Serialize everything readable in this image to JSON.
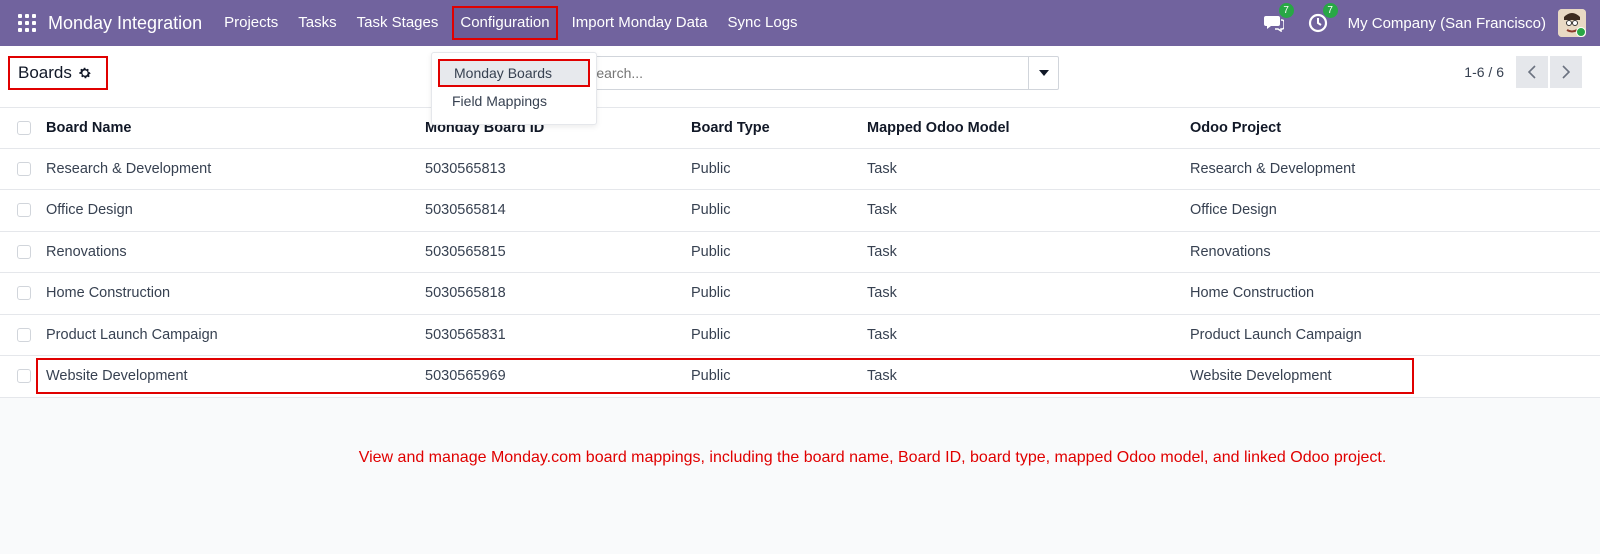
{
  "navbar": {
    "brand": "Monday Integration",
    "menu": [
      "Projects",
      "Tasks",
      "Task Stages",
      "Configuration",
      "Import Monday Data",
      "Sync Logs"
    ],
    "messages_count": "7",
    "activities_count": "7",
    "company": "My Company (San Francisco)"
  },
  "control": {
    "breadcrumb": "Boards",
    "search_placeholder": "Search...",
    "pager": "1-6 / 6"
  },
  "dropdown": {
    "items": [
      "Monday Boards",
      "Field Mappings"
    ]
  },
  "table": {
    "headers": [
      "Board Name",
      "Monday Board ID",
      "Board Type",
      "Mapped Odoo Model",
      "Odoo Project"
    ],
    "rows": [
      [
        "Research & Development",
        "5030565813",
        "Public",
        "Task",
        "Research & Development"
      ],
      [
        "Office Design",
        "5030565814",
        "Public",
        "Task",
        "Office Design"
      ],
      [
        "Renovations",
        "5030565815",
        "Public",
        "Task",
        "Renovations"
      ],
      [
        "Home Construction",
        "5030565818",
        "Public",
        "Task",
        "Home Construction"
      ],
      [
        "Product Launch Campaign",
        "5030565831",
        "Public",
        "Task",
        "Product Launch Campaign"
      ],
      [
        "Website Development",
        "5030565969",
        "Public",
        "Task",
        "Website Development"
      ]
    ]
  },
  "note": "View and manage Monday.com board mappings, including the board name, Board ID, board type, mapped Odoo model, and linked Odoo project."
}
